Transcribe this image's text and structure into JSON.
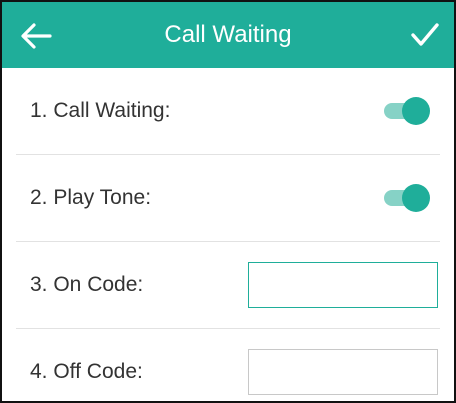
{
  "header": {
    "title": "Call Waiting",
    "back_icon": "arrow-left-icon",
    "confirm_icon": "checkmark-icon",
    "color": "#1fae9a"
  },
  "settings": [
    {
      "label": "1. Call Waiting:",
      "type": "toggle",
      "value": "on"
    },
    {
      "label": "2. Play Tone:",
      "type": "toggle",
      "value": "on"
    },
    {
      "label": "3. On Code:",
      "type": "text",
      "value": ""
    },
    {
      "label": "4. Off Code:",
      "type": "text",
      "value": ""
    }
  ],
  "accent_color": "#1fae9a"
}
